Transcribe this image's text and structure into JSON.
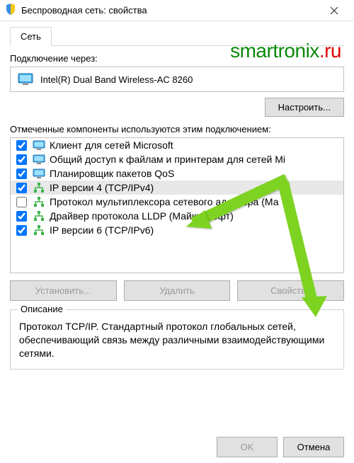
{
  "window": {
    "title": "Беспроводная сеть: свойства"
  },
  "watermark": {
    "main": "smartronix",
    "suffix": ".ru"
  },
  "tab": {
    "label": "Сеть"
  },
  "connect_via_label": "Подключение через:",
  "adapter": {
    "name": "Intel(R) Dual Band Wireless-AC 8260"
  },
  "configure_btn": "Настроить...",
  "components_label": "Отмеченные компоненты используются этим подключением:",
  "components": [
    {
      "checked": true,
      "icon": "screen",
      "label": "Клиент для сетей Microsoft"
    },
    {
      "checked": true,
      "icon": "screen",
      "label": "Общий доступ к файлам и принтерам для сетей Mi"
    },
    {
      "checked": true,
      "icon": "screen",
      "label": "Планировщик пакетов QoS"
    },
    {
      "checked": true,
      "icon": "net",
      "label": "IP версии 4 (TCP/IPv4)",
      "selected": true
    },
    {
      "checked": false,
      "icon": "net",
      "label": "Протокол мультиплексора сетевого адаптера (Ма"
    },
    {
      "checked": true,
      "icon": "net",
      "label": "Драйвер протокола LLDP (Майкрософт)"
    },
    {
      "checked": true,
      "icon": "net",
      "label": "IP версии 6 (TCP/IPv6)"
    }
  ],
  "buttons": {
    "install": "Установить...",
    "remove": "Удалить",
    "properties": "Свойства"
  },
  "description": {
    "legend": "Описание",
    "text": "Протокол TCP/IP. Стандартный протокол глобальных сетей, обеспечивающий связь между различными взаимодействующими сетями."
  },
  "dialog": {
    "ok": "OK",
    "cancel": "Отмена"
  },
  "arrow_color": "#7ed321"
}
